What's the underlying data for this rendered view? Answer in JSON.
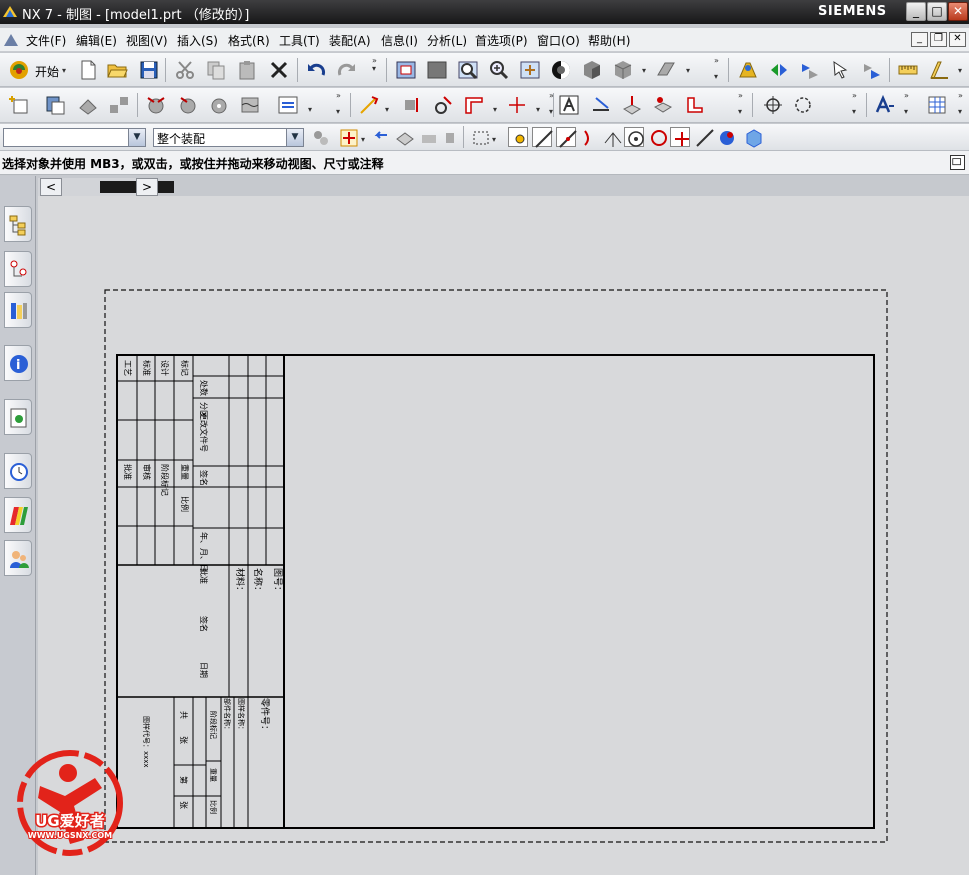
{
  "window": {
    "title": "NX 7 - 制图 - [model1.prt （修改的）]",
    "brand": "SIEMENS",
    "buttons": [
      "_",
      "□",
      "✕"
    ]
  },
  "menubar": {
    "items": [
      "文件(F)",
      "编辑(E)",
      "视图(V)",
      "插入(S)",
      "格式(R)",
      "工具(T)",
      "装配(A)",
      "信息(I)",
      "分析(L)",
      "首选项(P)",
      "窗口(O)",
      "帮助(H)"
    ],
    "mdi_buttons": [
      "_",
      "❐",
      "✕"
    ]
  },
  "toolbar1": {
    "start_label": "开始"
  },
  "toolbar3": {
    "filter_value": "",
    "scope_value": "整个装配"
  },
  "cue": {
    "message": "选择对象并使用 MB3，或双击，或按住并拖动来移动视图、尺寸或注释"
  },
  "sheet_tabs": {
    "prev": "<",
    "next": ">"
  },
  "resource_bar": {
    "icons": [
      "assembly-navigator-icon",
      "part-navigator-icon",
      "reuse-library-icon",
      "internet-explorer-icon",
      "history-icon",
      "clock-icon",
      "palette-icon",
      "roles-icon"
    ]
  },
  "title_block": {
    "labels_top": [
      "工艺",
      "标准",
      "设计",
      "标记",
      "处数",
      "分区",
      "更改文件号",
      "签名",
      "年、月、日"
    ],
    "labels_mid": [
      "批准",
      "审核",
      "阶段标记",
      "重量",
      "比例"
    ],
    "name_fields": [
      "材料：",
      "名称：",
      "图号："
    ],
    "company": "图样代号：xxxx",
    "part_no_label": "零件号：",
    "bottom_labels": [
      "共",
      "张",
      "第",
      "张"
    ],
    "side_labels": [
      "批准",
      "签名",
      "日期"
    ],
    "extra": [
      "部件名称：",
      "图样名称：",
      "零件号："
    ]
  },
  "watermark": {
    "text": "UG爱好者",
    "url": "WWW.UGSNX.COM"
  },
  "colors": {
    "titlebar": "#2a2a2b",
    "canvas": "#d8d9db",
    "watermark": "#e2231a"
  }
}
